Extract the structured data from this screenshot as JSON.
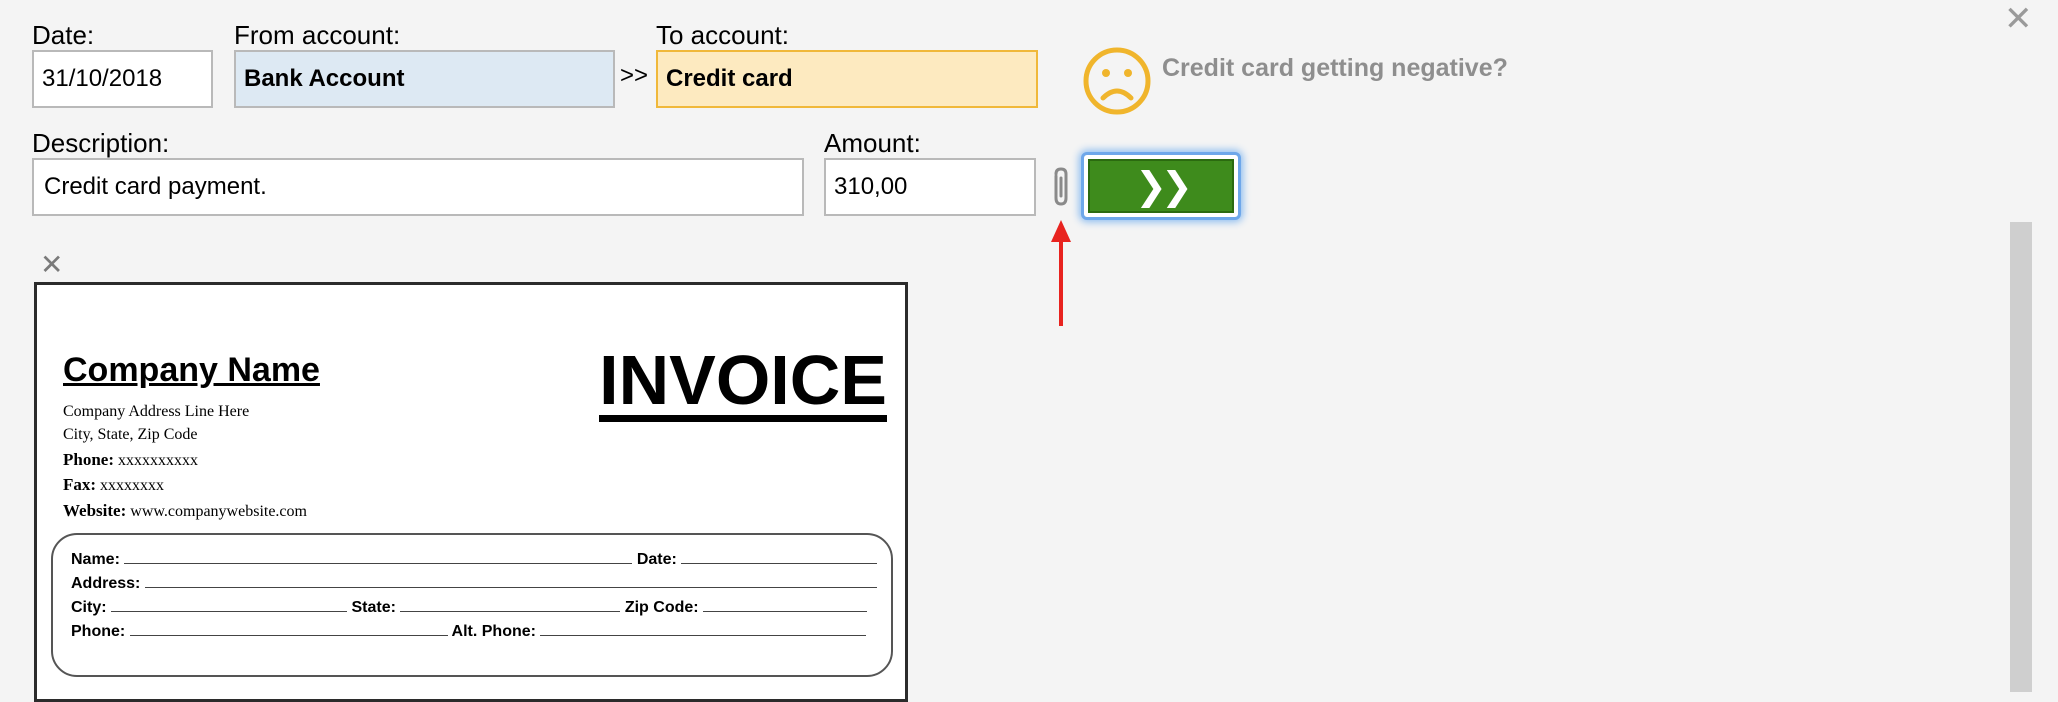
{
  "form": {
    "date_label": "Date:",
    "date_value": "31/10/2018",
    "from_label": "From account:",
    "from_value": "Bank Account",
    "transfer_symbol": ">>",
    "to_label": "To account:",
    "to_value": "Credit card",
    "warning_text": "Credit card getting negative?",
    "description_label": "Description:",
    "description_value": "Credit card payment.",
    "amount_label": "Amount:",
    "amount_value": "310,00",
    "submit_symbol": "❯❯",
    "close_symbol": "✕"
  },
  "attachment": {
    "close_symbol": "✕",
    "invoice": {
      "company_name": "Company Name",
      "title": "INVOICE",
      "address_line": "Company Address Line Here",
      "city_line": "City, State, Zip Code",
      "phone_label": "Phone:",
      "phone_value": "xxxxxxxxxx",
      "fax_label": "Fax:",
      "fax_value": "xxxxxxxx",
      "website_label": "Website:",
      "website_value": "www.companywebsite.com",
      "name_label": "Name:",
      "date_label": "Date:",
      "address_label": "Address:",
      "city_label": "City:",
      "state_label": "State:",
      "zip_label": "Zip Code:",
      "phone2_label": "Phone:",
      "alt_phone_label": "Alt. Phone:"
    }
  },
  "colors": {
    "from_account_bg": "#dde9f3",
    "to_account_bg": "#fdeac0",
    "warning_face": "#f0b52c",
    "submit_green": "#3e8b1c",
    "arrow_red": "#e8231f"
  },
  "icons": [
    "close-icon",
    "sad-face-icon",
    "paperclip-icon",
    "double-chevron-right-icon",
    "red-arrow-icon"
  ]
}
